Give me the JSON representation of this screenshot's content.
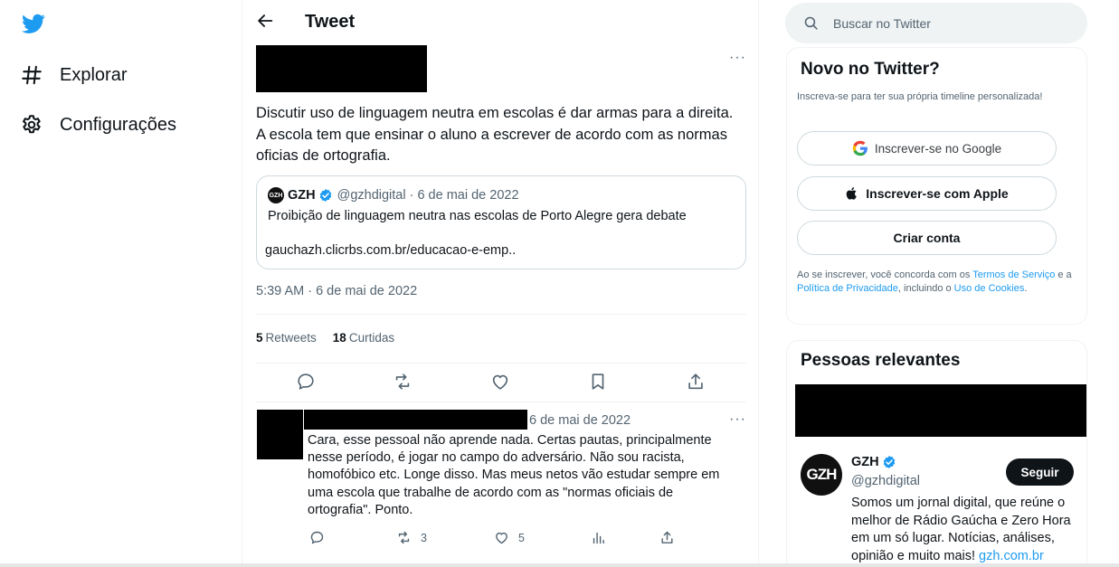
{
  "nav": {
    "items": [
      {
        "label": "Explorar",
        "icon": "hashtag-icon"
      },
      {
        "label": "Configurações",
        "icon": "gear-icon"
      }
    ]
  },
  "header": {
    "title": "Tweet"
  },
  "tweet": {
    "text": "Discutir uso de linguagem neutra em escolas é dar armas para a direita. A escola tem que ensinar o aluno a escrever de acordo com as normas oficias de ortografia.",
    "timestamp": "5:39 AM · 6 de mai de 2022",
    "retweets_count": "5",
    "retweets_label": "Retweets",
    "likes_count": "18",
    "likes_label": "Curtidas",
    "more": "···"
  },
  "quote": {
    "avatar_text": "GZH",
    "name": "GZH",
    "handle": "@gzhdigital",
    "date": "· 6 de mai de 2022",
    "text": "Proibição de linguagem neutra nas escolas de Porto Alegre gera debate",
    "link": "gauchazh.clicrbs.com.br/educacao-e-emp.."
  },
  "reply": {
    "date": "6 de mai de 2022",
    "text": "Cara, esse pessoal não aprende nada. Certas pautas, principalmente nesse período, é jogar no campo do adversário. Não sou racista, homofóbico etc. Longe disso. Mas meus netos vão estudar sempre em uma escola que trabalhe de acordo com as \"normas oficiais de ortografia\". Ponto.",
    "retweets": "3",
    "likes": "5",
    "more": "···"
  },
  "search": {
    "placeholder": "Buscar no Twitter"
  },
  "signup": {
    "title": "Novo no Twitter?",
    "subtitle": "Inscreva-se para ter sua própria timeline personalizada!",
    "google_label": "Inscrever-se no Google",
    "apple_label": "Inscrever-se com Apple",
    "create_label": "Criar conta",
    "legal_pre": "Ao se inscrever, você concorda com os ",
    "terms_link": "Termos de Serviço",
    "legal_mid": " e a ",
    "privacy_link": "Política de Privacidade",
    "legal_mid2": ", incluindo o ",
    "cookies_link": "Uso de Cookies",
    "legal_end": "."
  },
  "relevant": {
    "title": "Pessoas relevantes",
    "person": {
      "avatar_text": "GZH",
      "name": "GZH",
      "handle": "@gzhdigital",
      "follow_label": "Seguir",
      "bio": "Somos um jornal digital, que reúne o melhor de Rádio Gaúcha e Zero Hora em um só lugar. Notícias, análises, opinião e muito mais! ",
      "bio_link": "gzh.com.br"
    }
  },
  "colors": {
    "accent": "#1d9bf0",
    "text": "#0f1419",
    "muted": "#536471",
    "border": "#eff3f4"
  }
}
